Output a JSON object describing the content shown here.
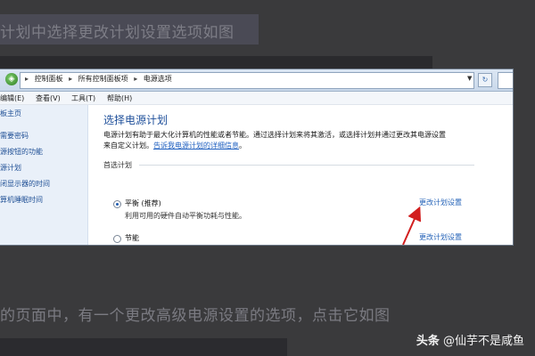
{
  "article": {
    "caption_top": "计划中选择更改计划设置选项如图",
    "caption_mid": "的页面中，有一个更改高级电源设置的选项，点击它如图",
    "watermark_brand": "头条",
    "watermark_author": "@仙芋不是咸鱼"
  },
  "window": {
    "breadcrumbs": [
      "控制面板",
      "所有控制面板项",
      "电源选项"
    ],
    "menu": [
      "编辑(E)",
      "查看(V)",
      "工具(T)",
      "帮助(H)"
    ],
    "sidebar": [
      "板主页",
      "需要密码",
      "源按钮的功能",
      "源计划",
      "闭显示器的时间",
      "算机睡眠时间"
    ],
    "title": "选择电源计划",
    "desc_line1": "电源计划有助于最大化计算机的性能或者节能。通过选择计划来将其激活，或选择计划并通过更改其电源设置",
    "desc_line2_prefix": "来自定义计划。",
    "desc_link": "告诉我电源计划的详细信息",
    "desc_line2_suffix": "。",
    "section_label": "首选计划",
    "plans": [
      {
        "name": "平衡 (推荐)",
        "desc": "利用可用的硬件自动平衡功耗与性能。",
        "link": "更改计划设置",
        "selected": true
      },
      {
        "name": "节能",
        "desc": "",
        "link": "更改计划设置",
        "selected": false
      }
    ]
  },
  "colors": {
    "accent": "#1e4f9a",
    "link": "#2563b8",
    "arrow": "#d21f1f"
  }
}
